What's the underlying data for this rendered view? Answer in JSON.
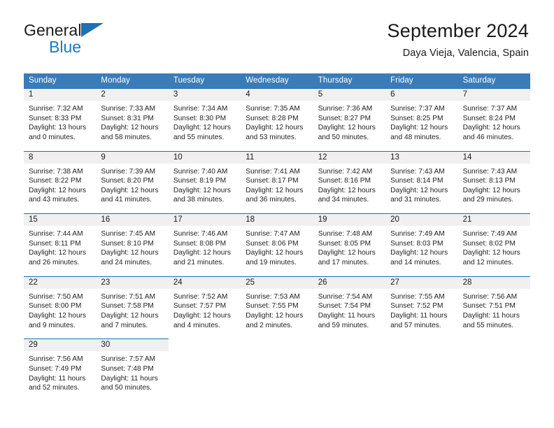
{
  "brand": {
    "name_top": "General",
    "name_bottom": "Blue",
    "triangle_color": "#1f6fb5",
    "bottom_color": "#1779c4"
  },
  "header": {
    "title": "September 2024",
    "subtitle": "Daya Vieja, Valencia, Spain"
  },
  "colors": {
    "header_row": "#3b7cb8",
    "row_rule": "#1f6fb5",
    "daynum_band": "#f0f0f0",
    "text": "#1a1a1a"
  },
  "weekdays": [
    "Sunday",
    "Monday",
    "Tuesday",
    "Wednesday",
    "Thursday",
    "Friday",
    "Saturday"
  ],
  "weeks": [
    [
      {
        "day": "1",
        "sunrise": "Sunrise: 7:32 AM",
        "sunset": "Sunset: 8:33 PM",
        "daylight1": "Daylight: 13 hours",
        "daylight2": "and 0 minutes."
      },
      {
        "day": "2",
        "sunrise": "Sunrise: 7:33 AM",
        "sunset": "Sunset: 8:31 PM",
        "daylight1": "Daylight: 12 hours",
        "daylight2": "and 58 minutes."
      },
      {
        "day": "3",
        "sunrise": "Sunrise: 7:34 AM",
        "sunset": "Sunset: 8:30 PM",
        "daylight1": "Daylight: 12 hours",
        "daylight2": "and 55 minutes."
      },
      {
        "day": "4",
        "sunrise": "Sunrise: 7:35 AM",
        "sunset": "Sunset: 8:28 PM",
        "daylight1": "Daylight: 12 hours",
        "daylight2": "and 53 minutes."
      },
      {
        "day": "5",
        "sunrise": "Sunrise: 7:36 AM",
        "sunset": "Sunset: 8:27 PM",
        "daylight1": "Daylight: 12 hours",
        "daylight2": "and 50 minutes."
      },
      {
        "day": "6",
        "sunrise": "Sunrise: 7:37 AM",
        "sunset": "Sunset: 8:25 PM",
        "daylight1": "Daylight: 12 hours",
        "daylight2": "and 48 minutes."
      },
      {
        "day": "7",
        "sunrise": "Sunrise: 7:37 AM",
        "sunset": "Sunset: 8:24 PM",
        "daylight1": "Daylight: 12 hours",
        "daylight2": "and 46 minutes."
      }
    ],
    [
      {
        "day": "8",
        "sunrise": "Sunrise: 7:38 AM",
        "sunset": "Sunset: 8:22 PM",
        "daylight1": "Daylight: 12 hours",
        "daylight2": "and 43 minutes."
      },
      {
        "day": "9",
        "sunrise": "Sunrise: 7:39 AM",
        "sunset": "Sunset: 8:20 PM",
        "daylight1": "Daylight: 12 hours",
        "daylight2": "and 41 minutes."
      },
      {
        "day": "10",
        "sunrise": "Sunrise: 7:40 AM",
        "sunset": "Sunset: 8:19 PM",
        "daylight1": "Daylight: 12 hours",
        "daylight2": "and 38 minutes."
      },
      {
        "day": "11",
        "sunrise": "Sunrise: 7:41 AM",
        "sunset": "Sunset: 8:17 PM",
        "daylight1": "Daylight: 12 hours",
        "daylight2": "and 36 minutes."
      },
      {
        "day": "12",
        "sunrise": "Sunrise: 7:42 AM",
        "sunset": "Sunset: 8:16 PM",
        "daylight1": "Daylight: 12 hours",
        "daylight2": "and 34 minutes."
      },
      {
        "day": "13",
        "sunrise": "Sunrise: 7:43 AM",
        "sunset": "Sunset: 8:14 PM",
        "daylight1": "Daylight: 12 hours",
        "daylight2": "and 31 minutes."
      },
      {
        "day": "14",
        "sunrise": "Sunrise: 7:43 AM",
        "sunset": "Sunset: 8:13 PM",
        "daylight1": "Daylight: 12 hours",
        "daylight2": "and 29 minutes."
      }
    ],
    [
      {
        "day": "15",
        "sunrise": "Sunrise: 7:44 AM",
        "sunset": "Sunset: 8:11 PM",
        "daylight1": "Daylight: 12 hours",
        "daylight2": "and 26 minutes."
      },
      {
        "day": "16",
        "sunrise": "Sunrise: 7:45 AM",
        "sunset": "Sunset: 8:10 PM",
        "daylight1": "Daylight: 12 hours",
        "daylight2": "and 24 minutes."
      },
      {
        "day": "17",
        "sunrise": "Sunrise: 7:46 AM",
        "sunset": "Sunset: 8:08 PM",
        "daylight1": "Daylight: 12 hours",
        "daylight2": "and 21 minutes."
      },
      {
        "day": "18",
        "sunrise": "Sunrise: 7:47 AM",
        "sunset": "Sunset: 8:06 PM",
        "daylight1": "Daylight: 12 hours",
        "daylight2": "and 19 minutes."
      },
      {
        "day": "19",
        "sunrise": "Sunrise: 7:48 AM",
        "sunset": "Sunset: 8:05 PM",
        "daylight1": "Daylight: 12 hours",
        "daylight2": "and 17 minutes."
      },
      {
        "day": "20",
        "sunrise": "Sunrise: 7:49 AM",
        "sunset": "Sunset: 8:03 PM",
        "daylight1": "Daylight: 12 hours",
        "daylight2": "and 14 minutes."
      },
      {
        "day": "21",
        "sunrise": "Sunrise: 7:49 AM",
        "sunset": "Sunset: 8:02 PM",
        "daylight1": "Daylight: 12 hours",
        "daylight2": "and 12 minutes."
      }
    ],
    [
      {
        "day": "22",
        "sunrise": "Sunrise: 7:50 AM",
        "sunset": "Sunset: 8:00 PM",
        "daylight1": "Daylight: 12 hours",
        "daylight2": "and 9 minutes."
      },
      {
        "day": "23",
        "sunrise": "Sunrise: 7:51 AM",
        "sunset": "Sunset: 7:58 PM",
        "daylight1": "Daylight: 12 hours",
        "daylight2": "and 7 minutes."
      },
      {
        "day": "24",
        "sunrise": "Sunrise: 7:52 AM",
        "sunset": "Sunset: 7:57 PM",
        "daylight1": "Daylight: 12 hours",
        "daylight2": "and 4 minutes."
      },
      {
        "day": "25",
        "sunrise": "Sunrise: 7:53 AM",
        "sunset": "Sunset: 7:55 PM",
        "daylight1": "Daylight: 12 hours",
        "daylight2": "and 2 minutes."
      },
      {
        "day": "26",
        "sunrise": "Sunrise: 7:54 AM",
        "sunset": "Sunset: 7:54 PM",
        "daylight1": "Daylight: 11 hours",
        "daylight2": "and 59 minutes."
      },
      {
        "day": "27",
        "sunrise": "Sunrise: 7:55 AM",
        "sunset": "Sunset: 7:52 PM",
        "daylight1": "Daylight: 11 hours",
        "daylight2": "and 57 minutes."
      },
      {
        "day": "28",
        "sunrise": "Sunrise: 7:56 AM",
        "sunset": "Sunset: 7:51 PM",
        "daylight1": "Daylight: 11 hours",
        "daylight2": "and 55 minutes."
      }
    ],
    [
      {
        "day": "29",
        "sunrise": "Sunrise: 7:56 AM",
        "sunset": "Sunset: 7:49 PM",
        "daylight1": "Daylight: 11 hours",
        "daylight2": "and 52 minutes."
      },
      {
        "day": "30",
        "sunrise": "Sunrise: 7:57 AM",
        "sunset": "Sunset: 7:48 PM",
        "daylight1": "Daylight: 11 hours",
        "daylight2": "and 50 minutes."
      },
      {
        "day": "",
        "sunrise": "",
        "sunset": "",
        "daylight1": "",
        "daylight2": ""
      },
      {
        "day": "",
        "sunrise": "",
        "sunset": "",
        "daylight1": "",
        "daylight2": ""
      },
      {
        "day": "",
        "sunrise": "",
        "sunset": "",
        "daylight1": "",
        "daylight2": ""
      },
      {
        "day": "",
        "sunrise": "",
        "sunset": "",
        "daylight1": "",
        "daylight2": ""
      },
      {
        "day": "",
        "sunrise": "",
        "sunset": "",
        "daylight1": "",
        "daylight2": ""
      }
    ]
  ]
}
